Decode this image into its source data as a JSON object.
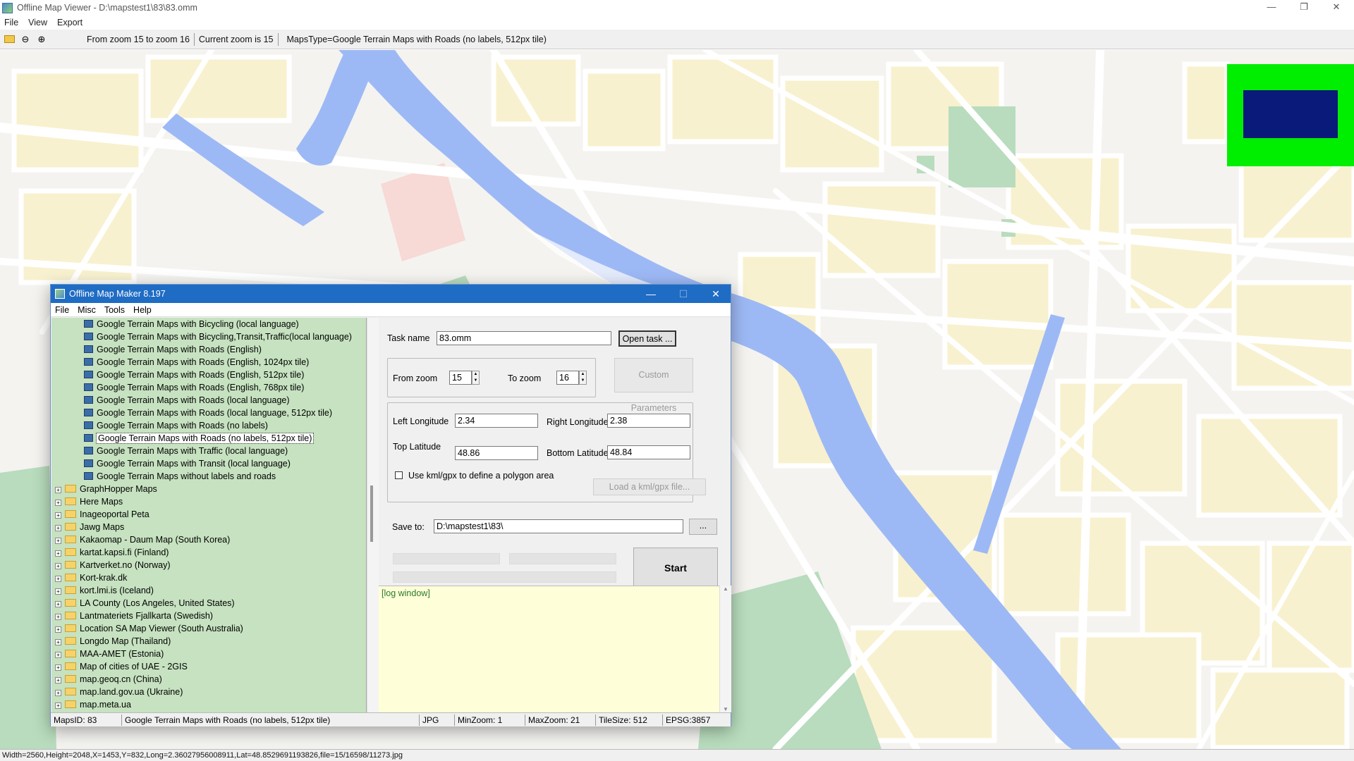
{
  "viewer": {
    "title": "Offline Map Viewer - D:\\mapstest1\\83\\83.omm",
    "menu": [
      "File",
      "View",
      "Export"
    ],
    "toolbar": {
      "zoom_range": "From zoom 15 to zoom 16",
      "current_zoom": "Current zoom is 15",
      "maps_type": "MapsType=Google Terrain Maps with Roads (no labels, 512px tile)"
    },
    "status": "Width=2560,Height=2048,X=1453,Y=832,Long=2.36027956008911,Lat=48.8529691193826,file=15/16598/11273.jpg",
    "icons": [
      "open-folder-icon",
      "zoom-out-icon",
      "zoom-in-icon"
    ]
  },
  "maker": {
    "title": "Offline Map Maker 8.197",
    "menu": [
      "File",
      "Misc",
      "Tools",
      "Help"
    ],
    "tree_maps": [
      "Google Terrain Maps with Bicycling (local language)",
      "Google Terrain Maps with Bicycling,Transit,Traffic(local language)",
      "Google Terrain Maps with Roads (English)",
      "Google Terrain Maps with Roads (English, 1024px tile)",
      "Google Terrain Maps with Roads (English, 512px tile)",
      "Google Terrain Maps with Roads (English, 768px tile)",
      "Google Terrain Maps with Roads (local language)",
      "Google Terrain Maps with Roads (local language, 512px tile)",
      "Google Terrain Maps with Roads (no labels)",
      "Google Terrain Maps with Roads (no labels, 512px tile)",
      "Google Terrain Maps with Traffic (local language)",
      "Google Terrain Maps with Transit (local language)",
      "Google Terrain Maps without labels and roads"
    ],
    "tree_selected_index": 9,
    "tree_folders": [
      "GraphHopper Maps",
      "Here Maps",
      "Inageoportal Peta",
      "Jawg Maps",
      "Kakaomap - Daum Map (South Korea)",
      "kartat.kapsi.fi (Finland)",
      "Kartverket.no (Norway)",
      "Kort-krak.dk",
      "kort.lmi.is (Iceland)",
      "LA County (Los Angeles, United States)",
      "Lantmateriets Fjallkarta (Swedish)",
      "Location SA Map Viewer (South Australia)",
      "Longdo Map (Thailand)",
      "MAA-AMET (Estonia)",
      "Map of cities of UAE - 2GIS",
      "map.geoq.cn (China)",
      "map.land.gov.ua (Ukraine)",
      "map.meta.ua"
    ],
    "form": {
      "task_name_label": "Task name",
      "task_name_value": "83.omm",
      "open_task": "Open task ...",
      "from_zoom_label": "From zoom",
      "from_zoom_value": "15",
      "to_zoom_label": "To zoom",
      "to_zoom_value": "16",
      "custom_parameters": "Custom Parameters",
      "left_longitude_label": "Left Longitude",
      "left_longitude_value": "2.34",
      "right_longitude_label": "Right Longitude",
      "right_longitude_value": "2.38",
      "top_latitude_label": "Top Latitude",
      "top_latitude_value": "48.86",
      "bottom_latitude_label": "Bottom Latitude",
      "bottom_latitude_value": "48.84",
      "use_kml_label": "Use kml/gpx to define a polygon area",
      "use_kml_checked": false,
      "load_kml": "Load a kml/gpx file...",
      "save_to_label": "Save to:",
      "save_to_value": "D:\\mapstest1\\83\\",
      "browse": "...",
      "start": "Start"
    },
    "log": "[log window]",
    "status": {
      "maps_id": "MapsID: 83",
      "maps_name": "Google Terrain Maps with Roads (no labels, 512px tile)",
      "format": "JPG",
      "min_zoom": "MinZoom: 1",
      "max_zoom": "MaxZoom: 21",
      "tile_size": "TileSize: 512",
      "epsg": "EPSG:3857"
    }
  },
  "colors": {
    "river": "#9db9f5",
    "park": "#b9dfc0",
    "block": "#f7f0cf",
    "road": "#ffffff",
    "tree_bg": "#c6e2c0",
    "overview_frame": "#00ee00",
    "overview_view": "#0a1a7a"
  }
}
